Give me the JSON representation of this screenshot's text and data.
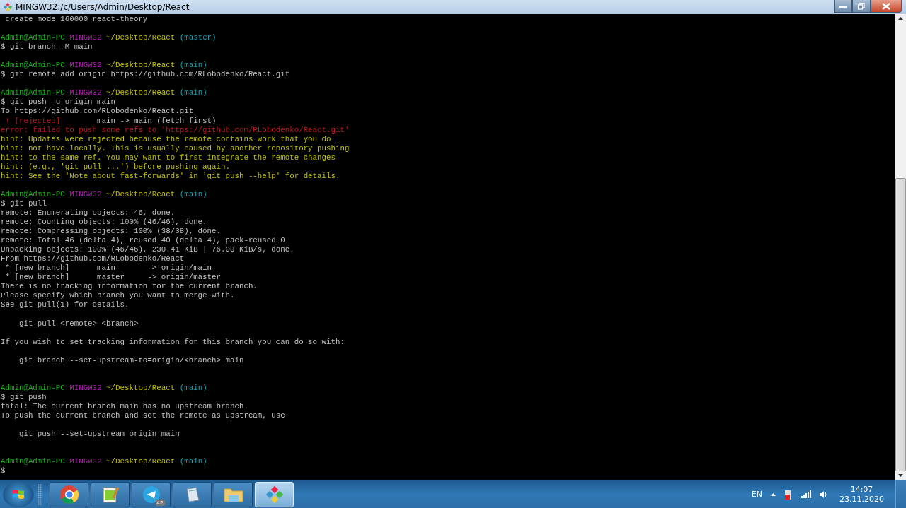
{
  "window": {
    "title": "MINGW32:/c/Users/Admin/Desktop/React"
  },
  "terminal": {
    "lines": [
      {
        "kind": "text",
        "segments": [
          {
            "kind": "plain",
            "text": " create mode 160000 react-theory"
          }
        ]
      },
      {
        "kind": "blank"
      },
      {
        "kind": "text",
        "segments": [
          {
            "kind": "user",
            "text": "Admin@Admin-PC"
          },
          {
            "kind": "system",
            "text": "MINGW32"
          },
          {
            "kind": "path",
            "text": "~/Desktop/React"
          },
          {
            "kind": "branch",
            "text": "(master)"
          }
        ]
      },
      {
        "kind": "text",
        "segments": [
          {
            "kind": "plain",
            "text": "$ git branch -M main"
          }
        ]
      },
      {
        "kind": "blank"
      },
      {
        "kind": "text",
        "segments": [
          {
            "kind": "user",
            "text": "Admin@Admin-PC"
          },
          {
            "kind": "system",
            "text": "MINGW32"
          },
          {
            "kind": "path",
            "text": "~/Desktop/React"
          },
          {
            "kind": "branch",
            "text": "(main)"
          }
        ]
      },
      {
        "kind": "text",
        "segments": [
          {
            "kind": "plain",
            "text": "$ git remote add origin https://github.com/RLobodenko/React.git"
          }
        ]
      },
      {
        "kind": "blank"
      },
      {
        "kind": "text",
        "segments": [
          {
            "kind": "user",
            "text": "Admin@Admin-PC"
          },
          {
            "kind": "system",
            "text": "MINGW32"
          },
          {
            "kind": "path",
            "text": "~/Desktop/React"
          },
          {
            "kind": "branch",
            "text": "(main)"
          }
        ]
      },
      {
        "kind": "text",
        "segments": [
          {
            "kind": "plain",
            "text": "$ git push -u origin main"
          }
        ]
      },
      {
        "kind": "text",
        "segments": [
          {
            "kind": "plain",
            "text": "To https://github.com/RLobodenko/React.git"
          }
        ]
      },
      {
        "kind": "text",
        "segments": [
          {
            "kind": "error",
            "text": " ! [rejected]"
          },
          {
            "kind": "plain",
            "text": "       main -> main (fetch first)"
          }
        ]
      },
      {
        "kind": "text",
        "segments": [
          {
            "kind": "error",
            "text": "error: failed to push some refs to 'https://github.com/RLobodenko/React.git'"
          }
        ]
      },
      {
        "kind": "text",
        "segments": [
          {
            "kind": "hint",
            "text": "hint: Updates were rejected because the remote contains work that you do"
          }
        ]
      },
      {
        "kind": "text",
        "segments": [
          {
            "kind": "hint",
            "text": "hint: not have locally. This is usually caused by another repository pushing"
          }
        ]
      },
      {
        "kind": "text",
        "segments": [
          {
            "kind": "hint",
            "text": "hint: to the same ref. You may want to first integrate the remote changes"
          }
        ]
      },
      {
        "kind": "text",
        "segments": [
          {
            "kind": "hint",
            "text": "hint: (e.g., 'git pull ...') before pushing again."
          }
        ]
      },
      {
        "kind": "text",
        "segments": [
          {
            "kind": "hint",
            "text": "hint: See the 'Note about fast-forwards' in 'git push --help' for details."
          }
        ]
      },
      {
        "kind": "blank"
      },
      {
        "kind": "text",
        "segments": [
          {
            "kind": "user",
            "text": "Admin@Admin-PC"
          },
          {
            "kind": "system",
            "text": "MINGW32"
          },
          {
            "kind": "path",
            "text": "~/Desktop/React"
          },
          {
            "kind": "branch",
            "text": "(main)"
          }
        ]
      },
      {
        "kind": "text",
        "segments": [
          {
            "kind": "plain",
            "text": "$ git pull"
          }
        ]
      },
      {
        "kind": "text",
        "segments": [
          {
            "kind": "plain",
            "text": "remote: Enumerating objects: 46, done."
          }
        ]
      },
      {
        "kind": "text",
        "segments": [
          {
            "kind": "plain",
            "text": "remote: Counting objects: 100% (46/46), done."
          }
        ]
      },
      {
        "kind": "text",
        "segments": [
          {
            "kind": "plain",
            "text": "remote: Compressing objects: 100% (38/38), done."
          }
        ]
      },
      {
        "kind": "text",
        "segments": [
          {
            "kind": "plain",
            "text": "remote: Total 46 (delta 4), reused 40 (delta 4), pack-reused 0"
          }
        ]
      },
      {
        "kind": "text",
        "segments": [
          {
            "kind": "plain",
            "text": "Unpacking objects: 100% (46/46), 230.41 KiB | 76.00 KiB/s, done."
          }
        ]
      },
      {
        "kind": "text",
        "segments": [
          {
            "kind": "plain",
            "text": "From https://github.com/RLobodenko/React"
          }
        ]
      },
      {
        "kind": "text",
        "segments": [
          {
            "kind": "plain",
            "text": " * [new branch]      main       -> origin/main"
          }
        ]
      },
      {
        "kind": "text",
        "segments": [
          {
            "kind": "plain",
            "text": " * [new branch]      master     -> origin/master"
          }
        ]
      },
      {
        "kind": "text",
        "segments": [
          {
            "kind": "plain",
            "text": "There is no tracking information for the current branch."
          }
        ]
      },
      {
        "kind": "text",
        "segments": [
          {
            "kind": "plain",
            "text": "Please specify which branch you want to merge with."
          }
        ]
      },
      {
        "kind": "text",
        "segments": [
          {
            "kind": "plain",
            "text": "See git-pull(1) for details."
          }
        ]
      },
      {
        "kind": "blank"
      },
      {
        "kind": "text",
        "segments": [
          {
            "kind": "plain",
            "text": "    git pull <remote> <branch>"
          }
        ]
      },
      {
        "kind": "blank"
      },
      {
        "kind": "text",
        "segments": [
          {
            "kind": "plain",
            "text": "If you wish to set tracking information for this branch you can do so with:"
          }
        ]
      },
      {
        "kind": "blank"
      },
      {
        "kind": "text",
        "segments": [
          {
            "kind": "plain",
            "text": "    git branch --set-upstream-to=origin/<branch> main"
          }
        ]
      },
      {
        "kind": "blank"
      },
      {
        "kind": "blank"
      },
      {
        "kind": "text",
        "segments": [
          {
            "kind": "user",
            "text": "Admin@Admin-PC"
          },
          {
            "kind": "system",
            "text": "MINGW32"
          },
          {
            "kind": "path",
            "text": "~/Desktop/React"
          },
          {
            "kind": "branch",
            "text": "(main)"
          }
        ]
      },
      {
        "kind": "text",
        "segments": [
          {
            "kind": "plain",
            "text": "$ git push"
          }
        ]
      },
      {
        "kind": "text",
        "segments": [
          {
            "kind": "plain",
            "text": "fatal: The current branch main has no upstream branch."
          }
        ]
      },
      {
        "kind": "text",
        "segments": [
          {
            "kind": "plain",
            "text": "To push the current branch and set the remote as upstream, use"
          }
        ]
      },
      {
        "kind": "blank"
      },
      {
        "kind": "text",
        "segments": [
          {
            "kind": "plain",
            "text": "    git push --set-upstream origin main"
          }
        ]
      },
      {
        "kind": "blank"
      },
      {
        "kind": "blank"
      },
      {
        "kind": "text",
        "segments": [
          {
            "kind": "user",
            "text": "Admin@Admin-PC"
          },
          {
            "kind": "system",
            "text": "MINGW32"
          },
          {
            "kind": "path",
            "text": "~/Desktop/React"
          },
          {
            "kind": "branch",
            "text": "(main)"
          }
        ]
      },
      {
        "kind": "text",
        "segments": [
          {
            "kind": "plain",
            "text": "$"
          }
        ]
      }
    ]
  },
  "taskbar": {
    "apps": [
      {
        "kind": "browser",
        "selected": false
      },
      {
        "kind": "editor",
        "selected": false
      },
      {
        "kind": "messenger",
        "selected": false,
        "badge": "42"
      },
      {
        "kind": "notepad",
        "selected": false
      },
      {
        "kind": "folder",
        "selected": false
      },
      {
        "kind": "git",
        "selected": true
      }
    ],
    "tray": {
      "language": "EN",
      "time": "14:07",
      "date": "23.11.2020"
    }
  }
}
